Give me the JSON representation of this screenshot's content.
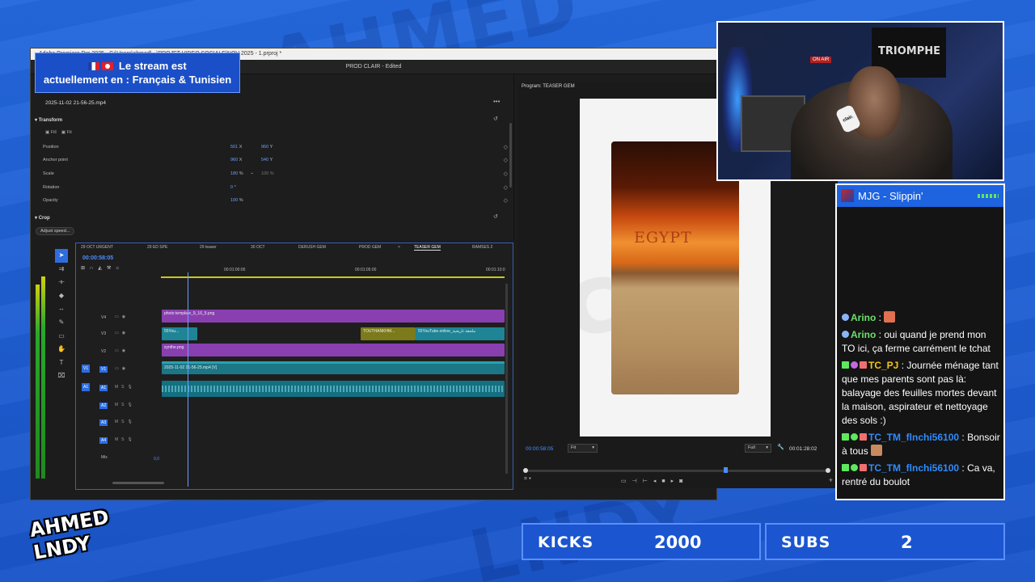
{
  "premiere": {
    "window_title": "Adobe Premiere Pro 2025 - C:\\Users\\ahmed\\...\\PROJET VIDEO SOCIALE\\NOV 2025 - 1.prproj *",
    "header": "PROD CLAIR - Edited",
    "effect_controls": {
      "clip_name": "2025-11-02 21-56-25.mp4",
      "transform_label": "Transform",
      "fill_label": "Fill",
      "fit_label": "Fit",
      "properties": [
        {
          "label": "Position",
          "v1": "501",
          "u1": "X",
          "v2": "960",
          "u2": "Y"
        },
        {
          "label": "Anchor point",
          "v1": "960",
          "u1": "X",
          "v2": "540",
          "u2": "Y"
        },
        {
          "label": "Scale",
          "v1": "180",
          "u1": "%",
          "v3": "100 %"
        },
        {
          "label": "Rotation",
          "v1": "0",
          "u1": "°"
        },
        {
          "label": "Opacity",
          "v1": "100",
          "u1": "%"
        }
      ],
      "crop_label": "Crop",
      "adjust_speed": "Adjust speed..."
    },
    "program": {
      "title": "Program: TEASER GEM",
      "video_text": "EGYPT",
      "timecode": "00:00:58:05",
      "fit": "Fit",
      "quality": "Full",
      "duration": "00:01:28:02"
    },
    "timeline": {
      "tabs": [
        "29 OCT URGENT",
        "29 ED SPE",
        "29 teaser",
        "30 OCT",
        "DERUSH GEM",
        "PROD GEM",
        "TEASER GEM",
        "RAMSES 2"
      ],
      "active_tab": "TEASER GEM",
      "timecode": "00:00:58:05",
      "ruler": [
        "00:01:00:00",
        "00:01:05:00",
        "00:01:10:0"
      ],
      "tracks": [
        "V4",
        "V3",
        "V2",
        "V1",
        "A1",
        "A2",
        "A3",
        "A4"
      ],
      "source_v": "V1",
      "source_a": "A1",
      "mix_label": "Mix",
      "mix_value": "0,0",
      "clips": {
        "v4": "photo template_9_16_5.png",
        "v3a": "55You...",
        "v3b": "TOUTHANKHM...",
        "v3c": "55YouTube.online_ملحقة تاريخية",
        "v2": "synthe.png",
        "v1": "2025-11-02 21-56-25.mp4 [V]"
      }
    }
  },
  "language_banner": {
    "line1": "Le stream est",
    "line2": "actuellement en : Français & Tunisien"
  },
  "webcam": {
    "banner_text": "TRIOMPHE",
    "on_air": "ON AIR",
    "mic_label": "clair."
  },
  "chat": {
    "now_playing": "MJG - Slippin'",
    "messages": [
      {
        "user": "Arino",
        "text": ""
      },
      {
        "user": "Arino",
        "text": "oui quand je prend mon TO ici, ça ferme carrément le tchat"
      },
      {
        "user": "TC_PJ",
        "text": "Journée ménage tant que mes parents sont pas là: balayage des feuilles mortes devant la maison, aspirateur et nettoyage des sols :)"
      },
      {
        "user": "TC_TM_flnchi56100",
        "text": "Bonsoir à tous"
      },
      {
        "user": "TC_TM_flnchi56100",
        "text": "Ca va, rentré du boulot"
      }
    ]
  },
  "logo": {
    "line1": "AHMED",
    "line2": "LNDY"
  },
  "counters": {
    "kicks_label": "KICKS",
    "kicks_value": "2000",
    "subs_label": "SUBS",
    "subs_value": "2"
  },
  "colors": {
    "background": "#1e5fd6",
    "accent_blue": "#2e6de0",
    "timecode_blue": "#4a8eff",
    "clip_purple": "#8a3fb0",
    "clip_teal": "#1e8496"
  }
}
